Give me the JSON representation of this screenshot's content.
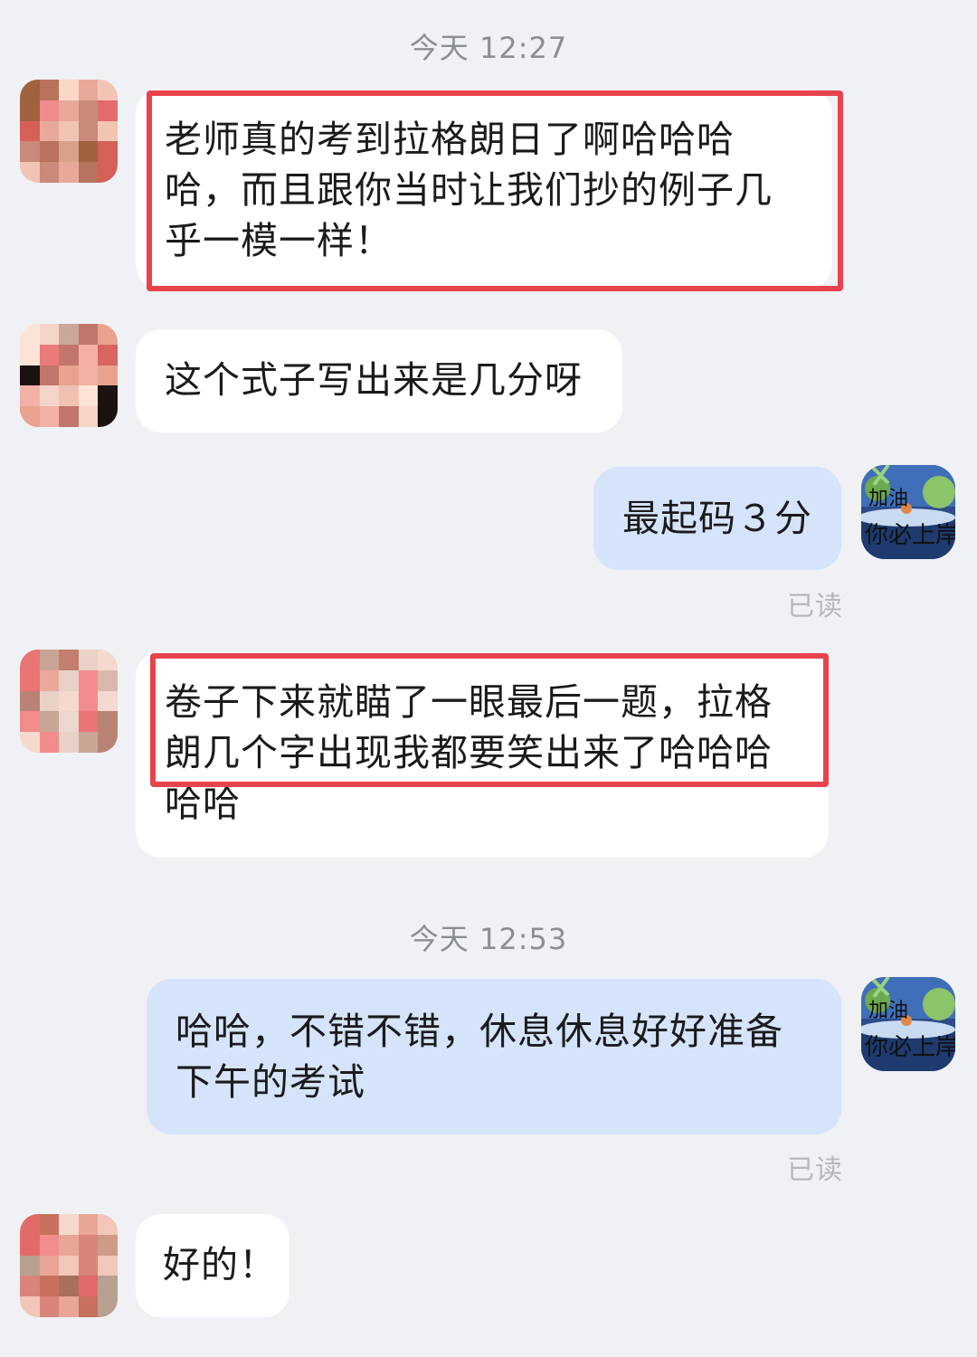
{
  "chat": {
    "timestamps": [
      "今天 12:27",
      "今天 12:53"
    ],
    "messages": [
      {
        "side": "left",
        "text": "老师真的考到拉格朗日了啊哈哈哈\n哈，而且跟你当时让我们抄的例子几\n乎一模一样！"
      },
      {
        "side": "left",
        "text": "这个式子写出来是几分呀"
      },
      {
        "side": "right",
        "text": "最起码３分"
      },
      {
        "side": "left",
        "text": "卷子下来就瞄了一眼最后一题，拉格\n朗几个字出现我都要笑出来了哈哈哈\n哈哈"
      },
      {
        "side": "right",
        "text": "哈哈，不错不错，休息休息好好准备\n下午的考试"
      },
      {
        "side": "left",
        "text": "好的！"
      }
    ],
    "read_label": "已读",
    "my_avatar_text": [
      "加油",
      "你必上岸"
    ]
  },
  "colors": {
    "background": "#eff1f4",
    "left_bubble": "#ffffff",
    "right_bubble": "#d5e4fb",
    "highlight_box": "#e8424d",
    "timestamp": "#8a8f96",
    "read": "#b5b9bf"
  }
}
